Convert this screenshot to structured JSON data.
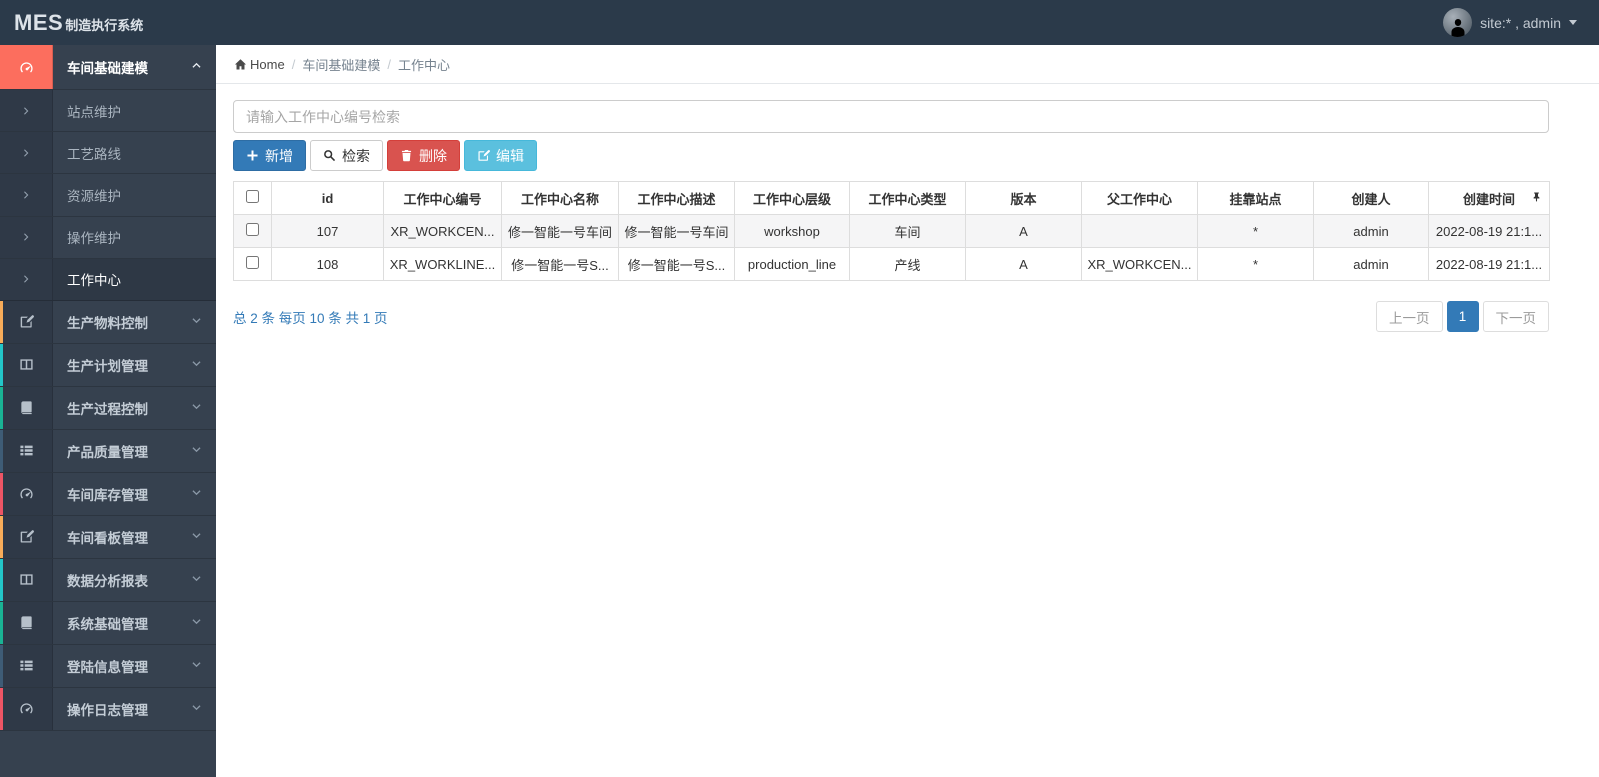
{
  "colors": {
    "navbar_bg": "#2b3a4a",
    "sidebar_bg": "#36414f",
    "active_accent": "#fc6e5e",
    "primary": "#337ab7",
    "danger": "#d9534f",
    "info": "#5bc0de",
    "link": "#337ab7",
    "strip_cycle": [
      "#f8ac59",
      "#23c6c8",
      "#1ab394",
      "#3e5c76",
      "#ed5565"
    ]
  },
  "navbar": {
    "logo_main": "MES",
    "logo_sub": "制造执行系统",
    "user_label": "site:* , admin"
  },
  "breadcrumb": {
    "home": "Home",
    "items": [
      "车间基础建模",
      "工作中心"
    ]
  },
  "sidebar": {
    "active_section": {
      "label": "车间基础建模",
      "icon": "dashboard-icon"
    },
    "submenu": [
      {
        "label": "站点维护",
        "active": false
      },
      {
        "label": "工艺路线",
        "active": false
      },
      {
        "label": "资源维护",
        "active": false
      },
      {
        "label": "操作维护",
        "active": false
      },
      {
        "label": "工作中心",
        "active": true
      }
    ],
    "sections": [
      {
        "label": "生产物料控制",
        "icon": "edit-icon"
      },
      {
        "label": "生产计划管理",
        "icon": "columns-icon"
      },
      {
        "label": "生产过程控制",
        "icon": "book-icon"
      },
      {
        "label": "产品质量管理",
        "icon": "list-icon"
      },
      {
        "label": "车间库存管理",
        "icon": "dashboard-icon"
      },
      {
        "label": "车间看板管理",
        "icon": "edit-icon"
      },
      {
        "label": "数据分析报表",
        "icon": "columns-icon"
      },
      {
        "label": "系统基础管理",
        "icon": "book-icon"
      },
      {
        "label": "登陆信息管理",
        "icon": "list-icon"
      },
      {
        "label": "操作日志管理",
        "icon": "dashboard-icon"
      }
    ]
  },
  "toolbar": {
    "search_placeholder": "请输入工作中心编号检索",
    "buttons": [
      {
        "label": "新增",
        "style": "primary",
        "icon": "plus-icon"
      },
      {
        "label": "检索",
        "style": "default",
        "icon": "search-icon"
      },
      {
        "label": "删除",
        "style": "danger",
        "icon": "trash-icon"
      },
      {
        "label": "编辑",
        "style": "info",
        "icon": "edit-icon"
      }
    ]
  },
  "table": {
    "columns": [
      "id",
      "工作中心编号",
      "工作中心名称",
      "工作中心描述",
      "工作中心层级",
      "工作中心类型",
      "版本",
      "父工作中心",
      "挂靠站点",
      "创建人",
      "创建时间"
    ],
    "rows": [
      {
        "cells": [
          "107",
          "XR_WORKCEN...",
          "修一智能一号车间",
          "修一智能一号车间",
          "workshop",
          "车间",
          "A",
          "",
          "*",
          "admin",
          "2022-08-19 21:1..."
        ]
      },
      {
        "cells": [
          "108",
          "XR_WORKLINE...",
          "修一智能一号S...",
          "修一智能一号S...",
          "production_line",
          "产线",
          "A",
          "XR_WORKCEN...",
          "*",
          "admin",
          "2022-08-19 21:1..."
        ]
      }
    ]
  },
  "pagination": {
    "summary": "总 2 条 每页 10 条 共 1 页",
    "prev": "上一页",
    "current": "1",
    "next": "下一页"
  }
}
